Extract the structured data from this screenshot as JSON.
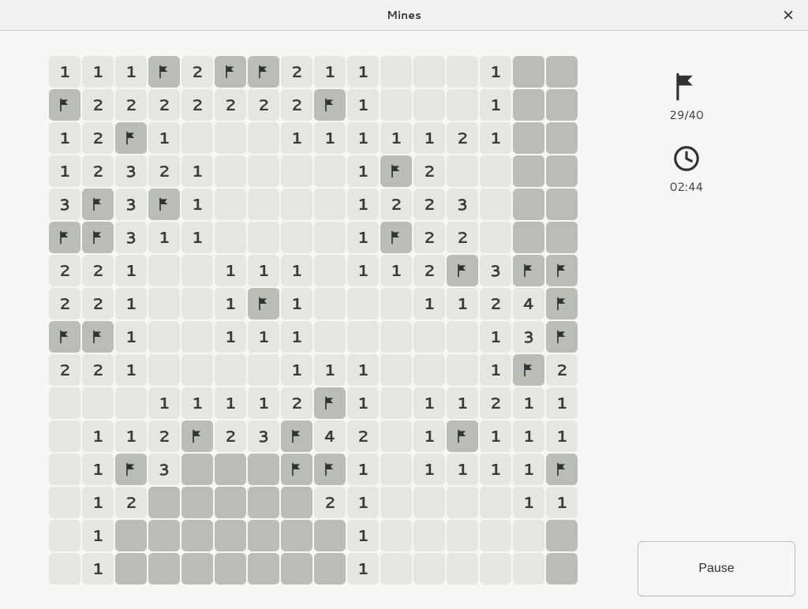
{
  "window": {
    "title": "Mines"
  },
  "status": {
    "flags_used": 29,
    "mine_total": 40,
    "flags_label": "29/40",
    "time": "02:44"
  },
  "controls": {
    "pause_label": "Pause"
  },
  "board": {
    "cols": 16,
    "rows": 16,
    "legend": "number = revealed count, '' = revealed blank, F = flag, . = still covered",
    "cells": [
      [
        "1",
        "1",
        "1",
        "F",
        "2",
        "F",
        "F",
        "2",
        "1",
        "1",
        "",
        "",
        "",
        "1",
        ".",
        "."
      ],
      [
        "F",
        "2",
        "2",
        "2",
        "2",
        "2",
        "2",
        "2",
        "F",
        "1",
        "",
        "",
        "",
        "1",
        ".",
        "."
      ],
      [
        "1",
        "2",
        "F",
        "1",
        "",
        "",
        "",
        "1",
        "1",
        "1",
        "1",
        "1",
        "2",
        "1",
        ".",
        "."
      ],
      [
        "1",
        "2",
        "3",
        "2",
        "1",
        "",
        "",
        "",
        "",
        "1",
        "F",
        "2",
        "",
        "",
        ".",
        "."
      ],
      [
        "3",
        "F",
        "3",
        "F",
        "1",
        "",
        "",
        "",
        "",
        "1",
        "2",
        "2",
        "3",
        "",
        ".",
        "."
      ],
      [
        "F",
        "F",
        "3",
        "1",
        "1",
        "",
        "",
        "",
        "",
        "1",
        "F",
        "2",
        "2",
        "",
        ".",
        "."
      ],
      [
        "2",
        "2",
        "1",
        "",
        "",
        "1",
        "1",
        "1",
        "",
        "1",
        "1",
        "2",
        "F",
        "3",
        "F",
        "F"
      ],
      [
        "2",
        "2",
        "1",
        "",
        "",
        "1",
        "F",
        "1",
        "",
        "",
        "",
        "1",
        "1",
        "2",
        "4",
        "F"
      ],
      [
        "F",
        "F",
        "1",
        "",
        "",
        "1",
        "1",
        "1",
        "",
        "",
        "",
        "",
        "",
        "1",
        "3",
        "F"
      ],
      [
        "2",
        "2",
        "1",
        "",
        "",
        "",
        "",
        "1",
        "1",
        "1",
        "",
        "",
        "",
        "1",
        "F",
        "2"
      ],
      [
        "",
        "",
        "",
        "1",
        "1",
        "1",
        "1",
        "2",
        "F",
        "1",
        "",
        "1",
        "1",
        "2",
        "1",
        "1"
      ],
      [
        "",
        "1",
        "1",
        "2",
        "F",
        "2",
        "3",
        "F",
        "4",
        "2",
        "",
        "1",
        "F",
        "1",
        "1",
        "1"
      ],
      [
        "",
        "1",
        "F",
        "3",
        ".",
        ".",
        ".",
        "F",
        "F",
        "1",
        "",
        "1",
        "1",
        "1",
        "1",
        "F"
      ],
      [
        "",
        "1",
        "2",
        ".",
        ".",
        ".",
        ".",
        ".",
        "2",
        "1",
        "",
        "",
        "",
        "",
        "1",
        "1"
      ],
      [
        "",
        "1",
        ".",
        ".",
        ".",
        ".",
        ".",
        ".",
        ".",
        "1",
        "",
        "",
        "",
        "",
        "",
        "."
      ],
      [
        "",
        "1",
        ".",
        ".",
        ".",
        ".",
        ".",
        ".",
        ".",
        "1",
        "",
        "",
        "",
        "",
        "",
        "."
      ]
    ]
  }
}
